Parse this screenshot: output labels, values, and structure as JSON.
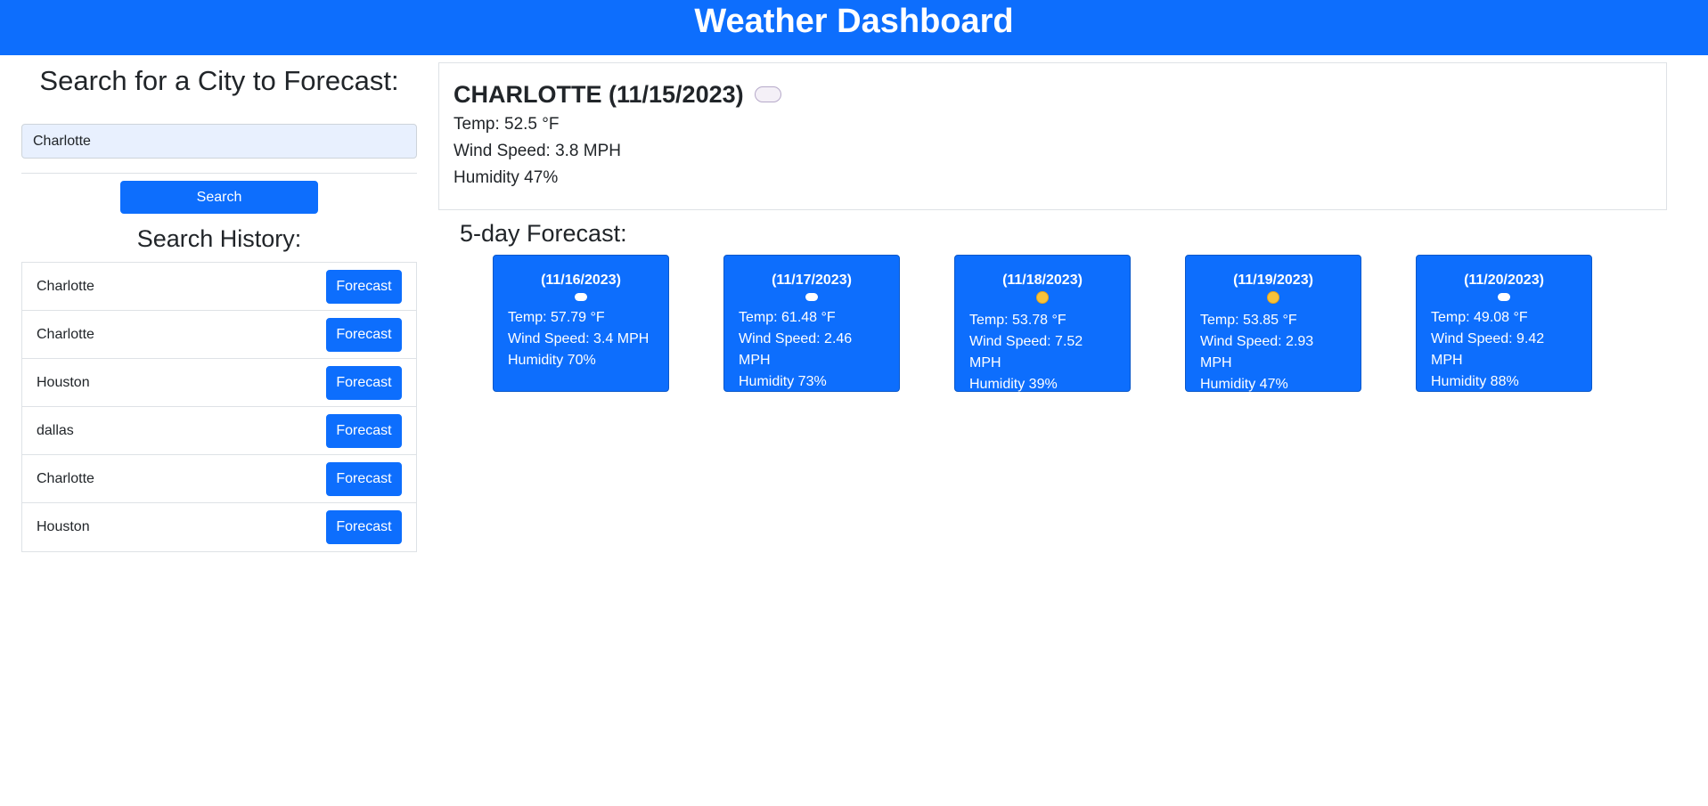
{
  "header": {
    "title": "Weather Dashboard"
  },
  "search": {
    "title": "Search for a City to Forecast:",
    "input_value": "Charlotte",
    "button_label": "Search"
  },
  "history": {
    "title": "Search History:",
    "items": [
      {
        "city": "Charlotte",
        "button": "Forecast"
      },
      {
        "city": "Charlotte",
        "button": "Forecast"
      },
      {
        "city": "Houston",
        "button": "Forecast"
      },
      {
        "city": "dallas",
        "button": "Forecast"
      },
      {
        "city": "Charlotte",
        "button": "Forecast"
      },
      {
        "city": "Houston",
        "button": "Forecast"
      }
    ]
  },
  "current": {
    "title": "CHARLOTTE (11/15/2023)",
    "icon": "cloud-icon",
    "temp": "Temp: 52.5 °F",
    "wind": "Wind Speed: 3.8 MPH",
    "humidity": "Humidity 47%"
  },
  "forecast": {
    "title": "5-day Forecast:",
    "days": [
      {
        "date": "(11/16/2023)",
        "icon": "cloud-icon",
        "temp": "Temp: 57.79 °F",
        "wind": "Wind Speed: 3.4 MPH",
        "humidity": "Humidity 70%"
      },
      {
        "date": "(11/17/2023)",
        "icon": "cloud-icon",
        "temp": "Temp: 61.48 °F",
        "wind": "Wind Speed: 2.46 MPH",
        "humidity": "Humidity 73%"
      },
      {
        "date": "(11/18/2023)",
        "icon": "sun-icon",
        "temp": "Temp: 53.78 °F",
        "wind": "Wind Speed: 7.52 MPH",
        "humidity": "Humidity 39%"
      },
      {
        "date": "(11/19/2023)",
        "icon": "sun-icon",
        "temp": "Temp: 53.85 °F",
        "wind": "Wind Speed: 2.93 MPH",
        "humidity": "Humidity 47%"
      },
      {
        "date": "(11/20/2023)",
        "icon": "cloud-icon",
        "temp": "Temp: 49.08 °F",
        "wind": "Wind Speed: 9.42 MPH",
        "humidity": "Humidity 88%"
      }
    ]
  },
  "colors": {
    "primary": "#0d6efd",
    "border": "#dee2e6",
    "input_bg": "#e8f0fe"
  }
}
